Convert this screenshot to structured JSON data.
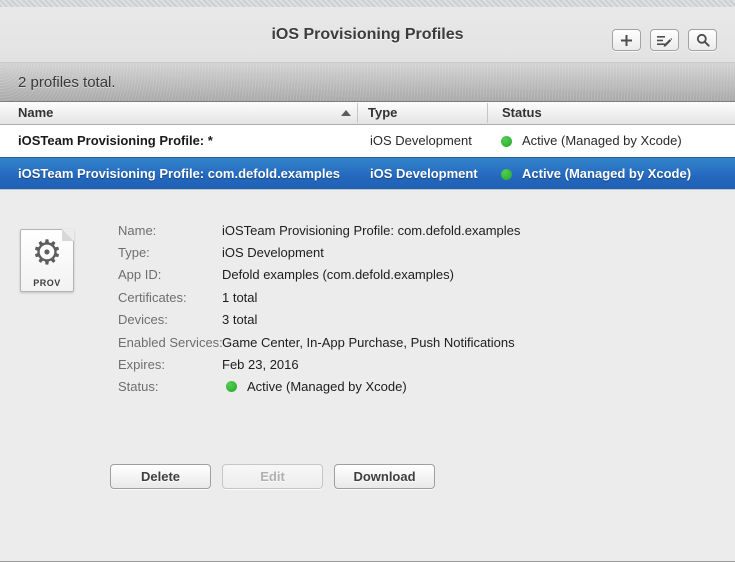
{
  "window": {
    "title": "iOS Provisioning Profiles"
  },
  "summary": {
    "text": "2 profiles total."
  },
  "table": {
    "columns": [
      "Name",
      "Type",
      "Status"
    ],
    "sort": {
      "column": "Name",
      "direction": "ascending"
    },
    "rows": [
      {
        "name": "iOSTeam Provisioning Profile: *",
        "type": "iOS Development",
        "status": "Active (Managed by Xcode)",
        "selected": false
      },
      {
        "name": "iOSTeam Provisioning Profile: com.defold.examples",
        "type": "iOS Development",
        "status": "Active (Managed by Xcode)",
        "selected": true
      }
    ]
  },
  "detail": {
    "icon_label": "PROV",
    "fields": [
      {
        "label": "Name:",
        "value": "iOSTeam Provisioning Profile: com.defold.examples"
      },
      {
        "label": "Type:",
        "value": "iOS Development"
      },
      {
        "label": "App ID:",
        "value": "Defold examples (com.defold.examples)"
      },
      {
        "label": "Certificates:",
        "value": "1 total"
      },
      {
        "label": "Devices:",
        "value": "3 total"
      },
      {
        "label": "Enabled Services:",
        "value": "Game Center, In-App Purchase, Push Notifications"
      },
      {
        "label": "Expires:",
        "value": "Feb 23, 2016"
      },
      {
        "label": "Status:",
        "value": "Active (Managed by Xcode)"
      }
    ],
    "buttons": {
      "delete": "Delete",
      "edit": "Edit",
      "download": "Download"
    }
  },
  "colors": {
    "selection_blue_top": "#3484cb",
    "selection_blue_bottom": "#1e60b4",
    "status_green": "#2eb82e",
    "background_gray": "#ececec"
  }
}
